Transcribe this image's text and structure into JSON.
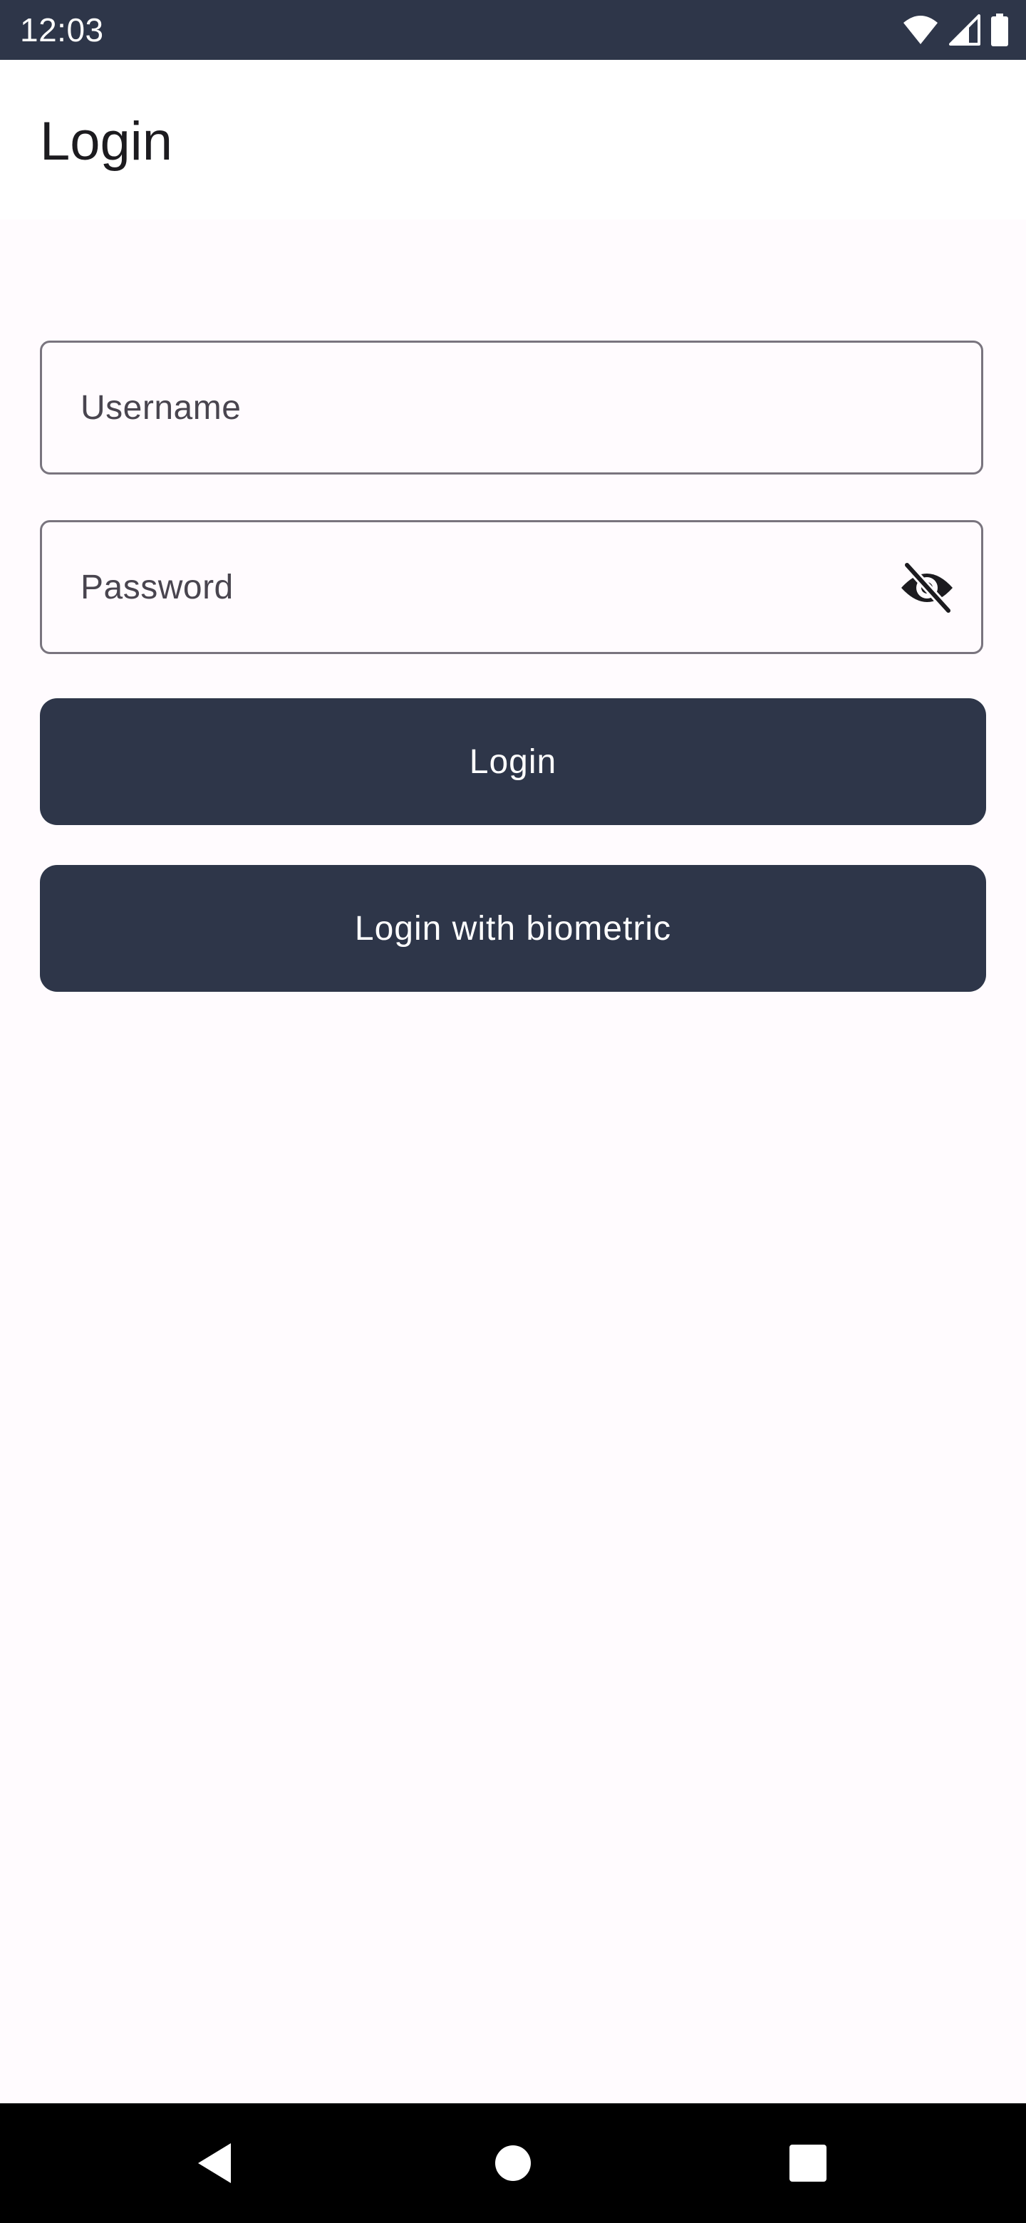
{
  "status_bar": {
    "time": "12:03",
    "icons": [
      "wifi-icon",
      "cellular-signal-icon",
      "battery-icon"
    ]
  },
  "app_bar": {
    "title": "Login"
  },
  "form": {
    "username": {
      "placeholder": "Username",
      "value": ""
    },
    "password": {
      "placeholder": "Password",
      "value": "",
      "toggle_icon": "visibility-off-icon"
    },
    "login_button_label": "Login",
    "biometric_button_label": "Login with biometric"
  },
  "navigation_bar": {
    "icons": [
      "back-icon",
      "home-icon",
      "recents-icon"
    ]
  },
  "colors": {
    "primary": "#2e3649",
    "background": "#fffbfe",
    "surface": "#ffffff",
    "outline": "#79747e",
    "on_primary": "#ffffff"
  }
}
